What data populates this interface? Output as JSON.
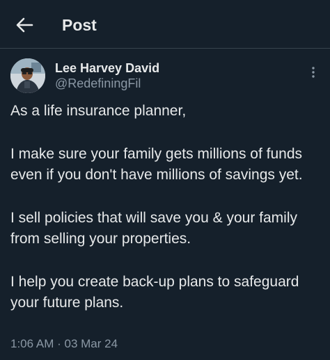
{
  "header": {
    "back_icon": "arrow-left-icon",
    "title": "Post"
  },
  "post": {
    "author_name": "Lee Harvey David",
    "author_handle": "@RedefiningFil",
    "more_icon": "more-vertical-icon",
    "paragraphs": [
      "As a life insurance planner,",
      "I make sure your family gets millions of funds even if you don't have millions of savings yet.",
      "I sell policies that will save you & your family from selling your properties.",
      "I help you create back-up plans to safeguard your future plans."
    ],
    "time": "1:06 AM",
    "separator": "·",
    "date": "03 Mar 24"
  },
  "colors": {
    "background": "#15202b",
    "text": "#e7e9ea",
    "secondary_text": "#8b98a5",
    "divider": "#38444d"
  }
}
